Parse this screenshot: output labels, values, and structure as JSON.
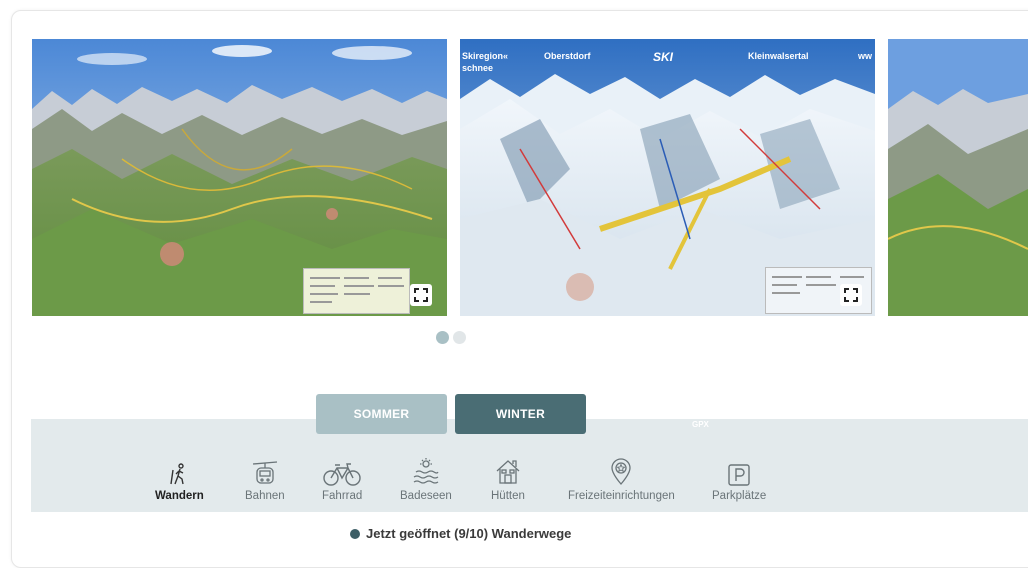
{
  "carousel": {
    "slides": [
      {
        "kind": "summer-panorama-map"
      },
      {
        "kind": "winter-ski-map",
        "header_texts": [
          "Skiregion«",
          "schnee",
          "Oberstdorf",
          "SKI",
          "Kleinwalsertal",
          "ww"
        ]
      },
      {
        "kind": "summer-panorama-map-partial"
      }
    ],
    "dots_count": 2,
    "active_dot": 1,
    "fullscreen_icon": "expand-icon"
  },
  "tabs": {
    "sommer_label": "SOMMER",
    "winter_label": "WINTER"
  },
  "gpx_label": "GPX",
  "categories": [
    {
      "label": "Wandern",
      "icon": "hiker-icon",
      "active": true
    },
    {
      "label": "Bahnen",
      "icon": "gondola-icon"
    },
    {
      "label": "Fahrrad",
      "icon": "bicycle-icon"
    },
    {
      "label": "Badeseen",
      "icon": "lake-icon"
    },
    {
      "label": "Hütten",
      "icon": "hut-icon"
    },
    {
      "label": "Freizeiteinrichtungen",
      "icon": "location-pin-icon"
    },
    {
      "label": "Parkplätze",
      "icon": "parking-icon"
    }
  ],
  "status": {
    "text": "Jetzt geöffnet (9/10) Wanderwege"
  },
  "colors": {
    "tab_inactive": "#a9c0c5",
    "tab_active": "#4a6d74",
    "panel_bg": "#e3eaec",
    "dot_active": "#a9c0c5",
    "dot_inactive": "#e1e6e8",
    "status_bullet": "#3d5e66"
  }
}
